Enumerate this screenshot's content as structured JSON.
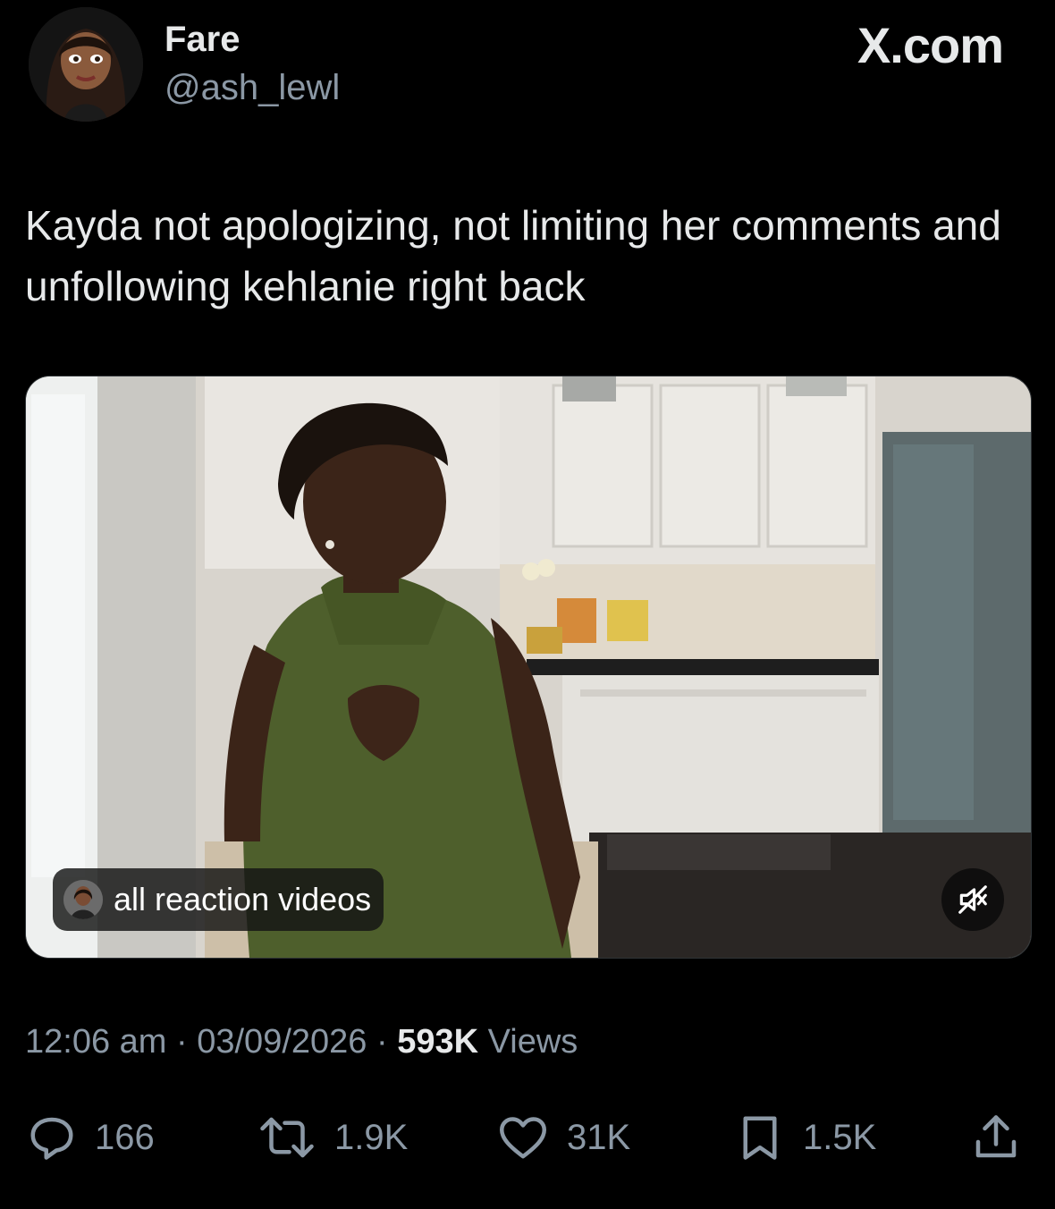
{
  "header": {
    "display_name": "Fare",
    "handle": "@ash_lewl",
    "brand": "X.com"
  },
  "tweet": {
    "text": "Kayda not apologizing, not limiting her comments and unfollowing kehlanie right back"
  },
  "media": {
    "badge_label": "all reaction videos",
    "mute_icon": "volume-muted-icon"
  },
  "meta": {
    "time": "12:06 am",
    "separator": "·",
    "date": "03/09/2026",
    "views_count": "593K",
    "views_label": "Views"
  },
  "actions": {
    "replies": "166",
    "reposts": "1.9K",
    "likes": "31K",
    "bookmarks": "1.5K"
  },
  "colors": {
    "background": "#000000",
    "text_primary": "#e7e9ea",
    "text_secondary": "#8b98a5",
    "dress_green": "#4e5f2c"
  }
}
